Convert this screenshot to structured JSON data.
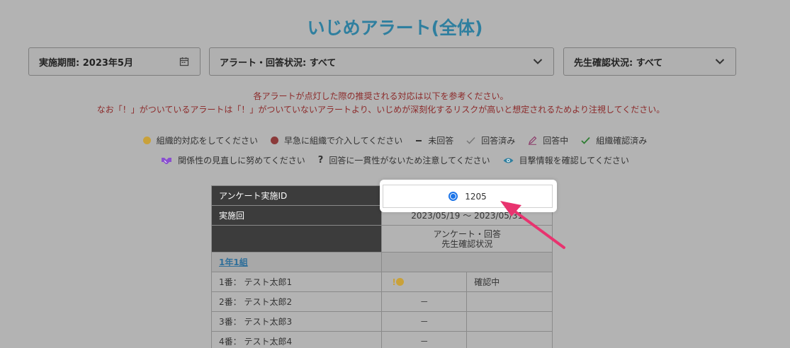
{
  "page": {
    "title": "いじめアラート(全体)"
  },
  "filters": {
    "period": "実施期間: 2023年5月",
    "alert_status": "アラート・回答状況: すべて",
    "teacher_status": "先生確認状況: すべて"
  },
  "notice": {
    "line1": "各アラートが点灯した際の推奨される対応は以下を参考ください。",
    "line2": "なお「！」がついているアラートは「！」がついていないアラートより、いじめが深刻化するリスクが高いと想定されるためより注視してください。"
  },
  "legend": {
    "row1": [
      {
        "icon": "orange-dot-icon",
        "label": "組織的対応をしてください"
      },
      {
        "icon": "red-dot-icon",
        "label": "早急に組織で介入してください"
      },
      {
        "icon": "dash-icon",
        "label": "未回答"
      },
      {
        "icon": "check-icon",
        "label": "回答済み"
      },
      {
        "icon": "pencil-icon",
        "label": "回答中"
      },
      {
        "icon": "green-check-icon",
        "label": "組織確認済み"
      }
    ],
    "row2": [
      {
        "icon": "handshake-icon",
        "label": "関係性の見直しに努めてください"
      },
      {
        "icon": "question-icon",
        "label": "回答に一貫性がないため注意してください"
      },
      {
        "icon": "eye-icon",
        "label": "目撃情報を確認してください"
      }
    ]
  },
  "table": {
    "survey_id_label": "アンケート実施ID",
    "survey_id_value": "1205",
    "round_label": "実施回",
    "round_value": "2023/05/19 ～ 2023/05/31",
    "status_header_1": "アンケート・回答",
    "status_header_2": "先生確認状況",
    "class_name": "1年1組",
    "rows": [
      {
        "name": "1番： テスト太郎1",
        "answer": "!",
        "confirm": "確認中"
      },
      {
        "name": "2番： テスト太郎2",
        "answer": "－",
        "confirm": ""
      },
      {
        "name": "3番： テスト太郎3",
        "answer": "－",
        "confirm": ""
      },
      {
        "name": "4番： テスト太郎4",
        "answer": "－",
        "confirm": ""
      }
    ]
  },
  "colors": {
    "title": "#2f7f9f",
    "notice": "#8c2a2a",
    "orange": "#c9a13a",
    "red": "#8b3a3a",
    "arrow": "#e8336f"
  }
}
